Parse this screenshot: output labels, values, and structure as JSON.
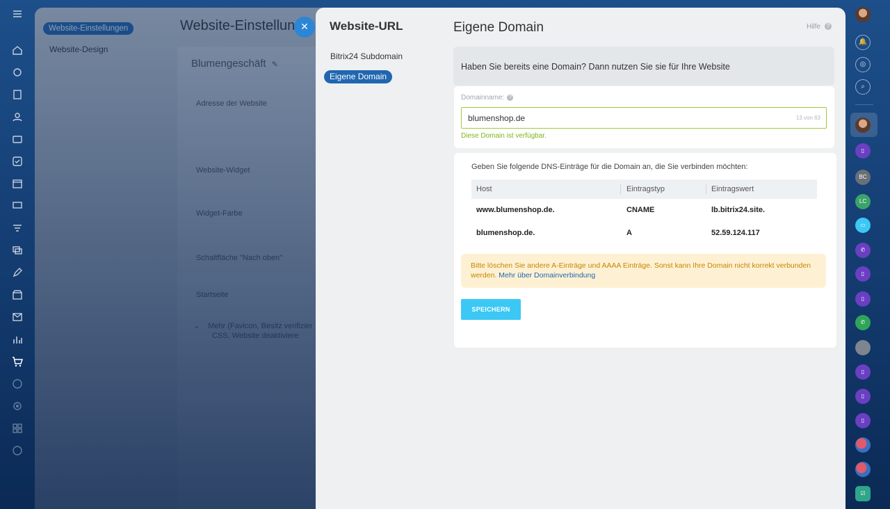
{
  "background_page": {
    "sidebar_active": "Website-Einstellungen",
    "sidebar_link": "Website-Design",
    "title": "Website-Einstellung",
    "card_title": "Blumengeschäft",
    "labels": [
      "Adresse der Website",
      "Website-Widget",
      "Widget-Farbe",
      "Schaltfläche \"Nach oben\"",
      "Startseite"
    ],
    "more_line1": "Mehr (Favicon, Besitz verifizier",
    "more_line2": "CSS, Website deaktiviere"
  },
  "slider": {
    "nav_title": "Website-URL",
    "nav_items": [
      {
        "label": "Bitrix24 Subdomain"
      },
      {
        "label": "Eigene Domain"
      }
    ],
    "title": "Eigene Domain",
    "help": "Hilfe",
    "help_icon": "?",
    "intro": "Haben Sie bereits eine Domain? Dann nutzen Sie sie für Ihre Website",
    "domain": {
      "label": "Domainname:",
      "value": "blumenshop.de",
      "char_count": "13 von 63",
      "status": "Diese Domain ist verfügbar."
    },
    "dns": {
      "intro": "Geben Sie folgende DNS-Einträge für die Domain an, die Sie verbinden möchten:",
      "headers": [
        "Host",
        "Eintragstyp",
        "Eintragswert"
      ],
      "rows": [
        [
          "www.blumenshop.de.",
          "CNAME",
          "lb.bitrix24.site."
        ],
        [
          "blumenshop.de.",
          "A",
          "52.59.124.117"
        ]
      ]
    },
    "warning": {
      "text": "Bitte löschen Sie andere A-Einträge und AAAA Einträge. Sonst kann Ihre Domain nicht korrekt verbunden werden.",
      "link": "Mehr über Domainverbindung"
    },
    "save_label": "SPEICHERN"
  },
  "right_rail": {
    "avatars": [
      {
        "text": "BC",
        "color": "#6b6f78"
      },
      {
        "text": "LC",
        "color": "#3aa36a"
      }
    ]
  },
  "colors": {
    "accent": "#2066b0",
    "button": "#3bc8f5",
    "success": "#7cb518",
    "warning_text": "#c78400"
  }
}
